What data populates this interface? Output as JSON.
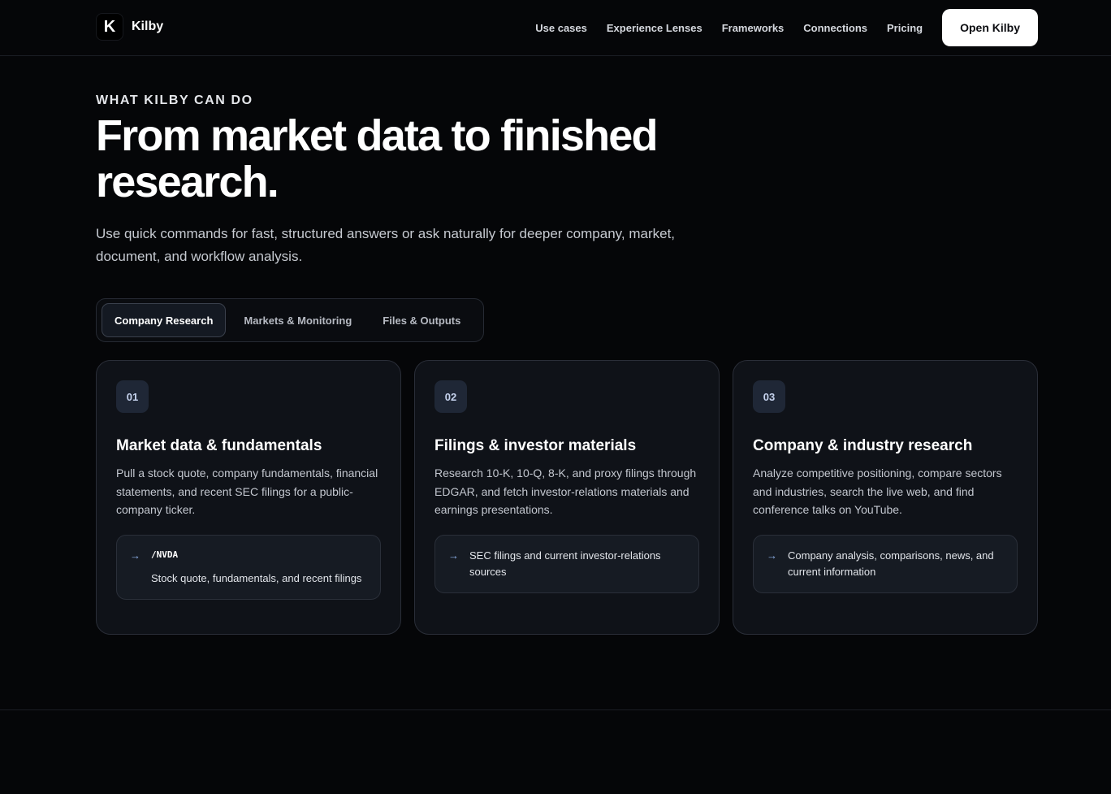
{
  "brand": {
    "logo_letter": "K",
    "name": "Kilby"
  },
  "nav": {
    "links": [
      "Use cases",
      "Experience Lenses",
      "Frameworks",
      "Connections",
      "Pricing"
    ],
    "cta": "Open Kilby"
  },
  "hero": {
    "eyebrow": "WHAT KILBY CAN DO",
    "headline": "From market data to finished research.",
    "subhead": "Use quick commands for fast, structured answers or ask naturally for deeper company, market, document, and workflow analysis."
  },
  "tabs": [
    {
      "label": "Company Research",
      "active": true
    },
    {
      "label": "Markets & Monitoring",
      "active": false
    },
    {
      "label": "Files & Outputs",
      "active": false
    }
  ],
  "cards": [
    {
      "number": "01",
      "title": "Market data & fundamentals",
      "description": "Pull a stock quote, company fundamentals, financial statements, and recent SEC filings for a public-company ticker.",
      "example": {
        "arrow": "→",
        "command": "/NVDA",
        "text": "Stock quote, fundamentals, and recent filings"
      }
    },
    {
      "number": "02",
      "title": "Filings & investor materials",
      "description": "Research 10-K, 10-Q, 8-K, and proxy filings through EDGAR, and fetch investor-relations materials and earnings presentations.",
      "example": {
        "arrow": "→",
        "text": "SEC filings and current investor-relations sources"
      }
    },
    {
      "number": "03",
      "title": "Company & industry research",
      "description": "Analyze competitive positioning, compare sectors and industries, search the live web, and find conference talks on YouTube.",
      "example": {
        "arrow": "→",
        "text": "Company analysis, comparisons, news, and current information"
      }
    }
  ],
  "colors": {
    "background": "#050608",
    "card_background": "#0f1218",
    "accent_arrow": "#8fb0ea",
    "badge_background": "#1f2736"
  }
}
